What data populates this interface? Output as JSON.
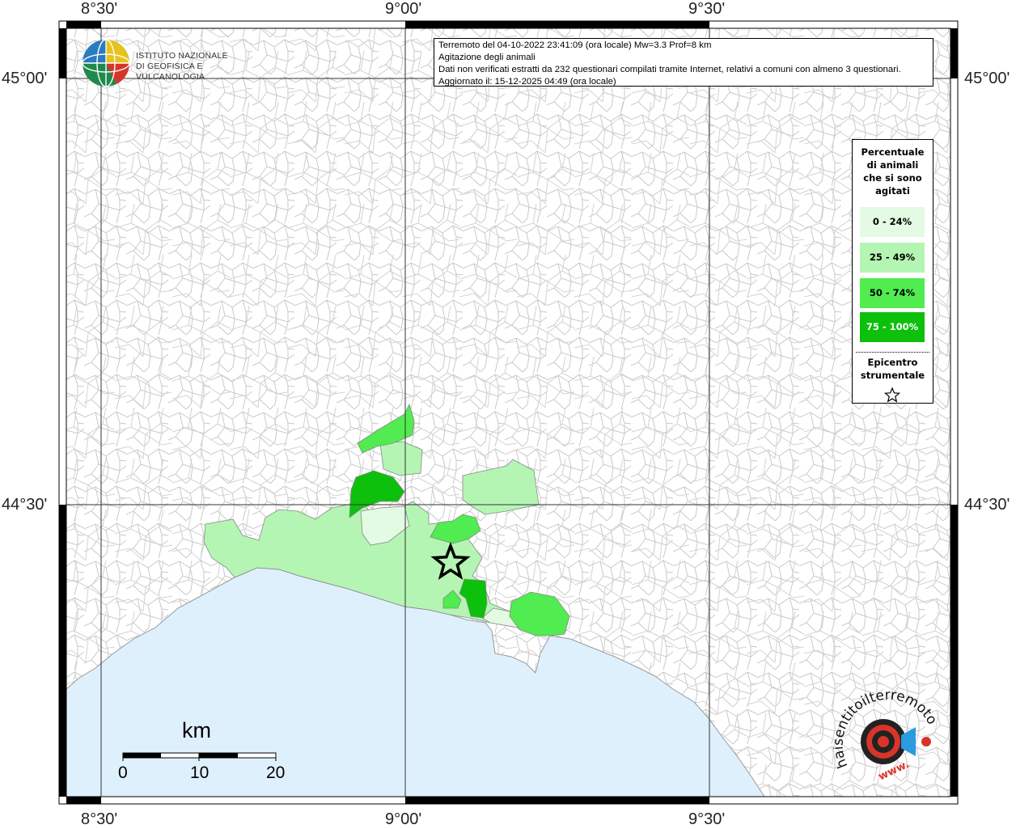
{
  "info": {
    "line1": "Terremoto del 04-10-2022 23:41:09 (ora locale) Mw=3.3 Prof=8 km",
    "line2": "Agitazione degli animali",
    "line3": "Dati non verificati estratti da 232 questionari compilati tramite Internet, relativi a comuni con almeno 3 questionari.",
    "line4": "Aggiornato il: 15-12-2025 04:49 (ora locale)"
  },
  "logo_ingv": {
    "line1": "ISTITUTO NAZIONALE",
    "line2": "DI GEOFISICA E VULCANOLOGIA"
  },
  "coordinates": {
    "top": [
      "8°30'",
      "9°00'",
      "9°30'"
    ],
    "bottom": [
      "8°30'",
      "9°00'",
      "9°30'"
    ],
    "left": [
      "45°00'",
      "44°30'"
    ],
    "right": [
      "45°00'",
      "44°30'"
    ]
  },
  "legend": {
    "title_lines": [
      "Percentuale",
      "di animali",
      "che si sono",
      "agitati"
    ],
    "classes": [
      {
        "label": "0 - 24%",
        "color": "#e3fbe3",
        "text_color": "#000000"
      },
      {
        "label": "25 - 49%",
        "color": "#b4f5b4",
        "text_color": "#000000"
      },
      {
        "label": "50 - 74%",
        "color": "#50ec50",
        "text_color": "#000000"
      },
      {
        "label": "75 - 100%",
        "color": "#0cc00c",
        "text_color": "#ffffff"
      }
    ],
    "epicenter_lines": [
      "Epicentro",
      "strumentale"
    ]
  },
  "scale": {
    "unit": "km",
    "ticks": [
      "0",
      "10",
      "20"
    ]
  },
  "logo_hse": {
    "text": "haisentitoilterremoto.it",
    "prefix": "www."
  },
  "colors": {
    "sea": "#dff0fd",
    "grid": "#333333",
    "boundary": "#c8c8c8"
  }
}
